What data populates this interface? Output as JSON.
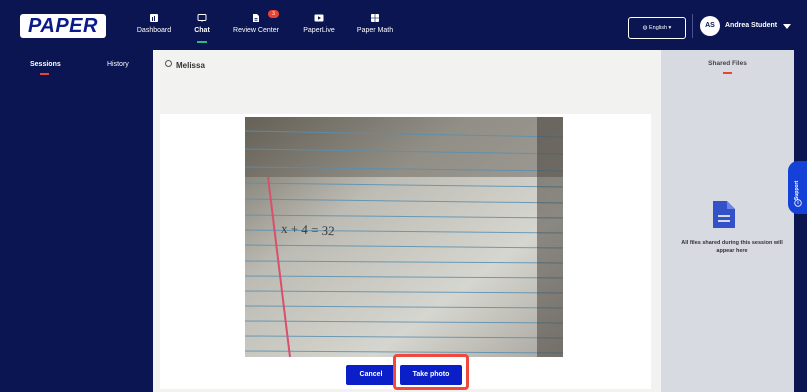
{
  "header": {
    "logo_text": "PAPER",
    "nav": [
      {
        "label": "Dashboard",
        "icon": "dashboard-icon"
      },
      {
        "label": "Chat",
        "icon": "chat-icon",
        "active": true
      },
      {
        "label": "Review Center",
        "icon": "document-icon",
        "badge": "3"
      },
      {
        "label": "PaperLive",
        "icon": "play-icon"
      },
      {
        "label": "Paper Math",
        "icon": "calculator-icon"
      }
    ],
    "language": "English",
    "avatar_initials": "AS",
    "user_name": "Andrea Student"
  },
  "sidebar": {
    "tabs": [
      {
        "label": "Sessions",
        "active": true
      },
      {
        "label": "History"
      }
    ]
  },
  "chat": {
    "tutor_name": "Melissa",
    "photo_text": "x + 4 = 32",
    "cancel_label": "Cancel",
    "take_photo_label": "Take photo"
  },
  "files": {
    "title": "Shared Files",
    "empty_text": "All files shared during this session will appear here"
  },
  "support_label": "Support",
  "colors": {
    "navy": "#0b1551",
    "primary_button": "#0a1fc7",
    "accent_red": "#e8442f",
    "active_green": "#29b886",
    "highlight_red": "#f0483b"
  }
}
